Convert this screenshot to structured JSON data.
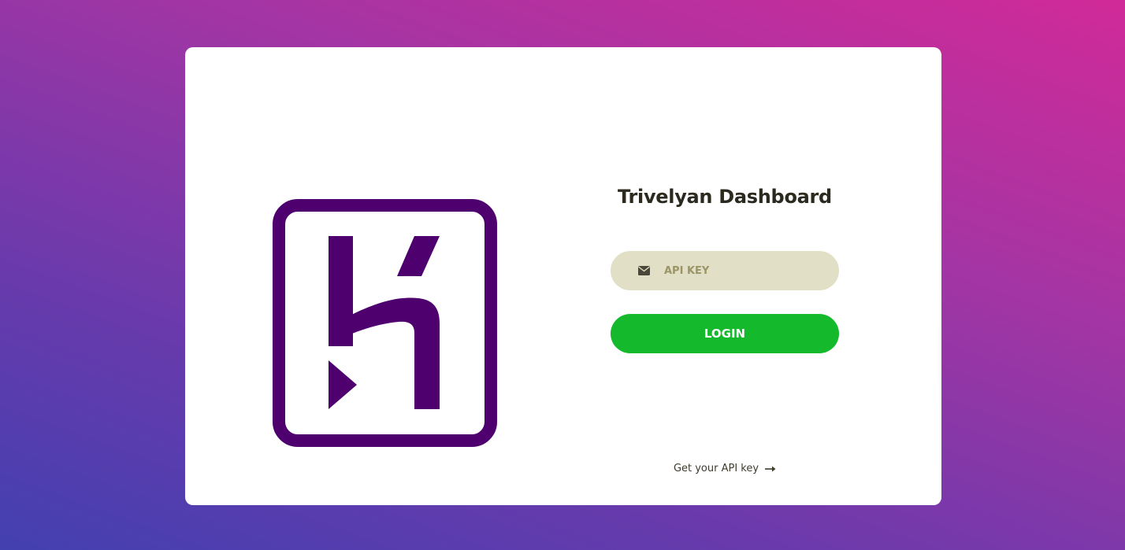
{
  "brand": {
    "logo_icon": "heroku-logo",
    "logo_color": "#4e006f"
  },
  "login": {
    "title": "Trivelyan Dashboard",
    "api_key_input": {
      "icon": "envelope-icon",
      "placeholder": "API KEY",
      "value": ""
    },
    "login_button_label": "LOGIN",
    "get_api_key_link": {
      "label": "Get your API key",
      "icon": "arrow-right-icon"
    }
  },
  "colors": {
    "accent_green": "#14b92c",
    "input_bg": "#e1dfc6",
    "background_gradient_start": "#4340b0",
    "background_gradient_end": "#d02a98"
  }
}
